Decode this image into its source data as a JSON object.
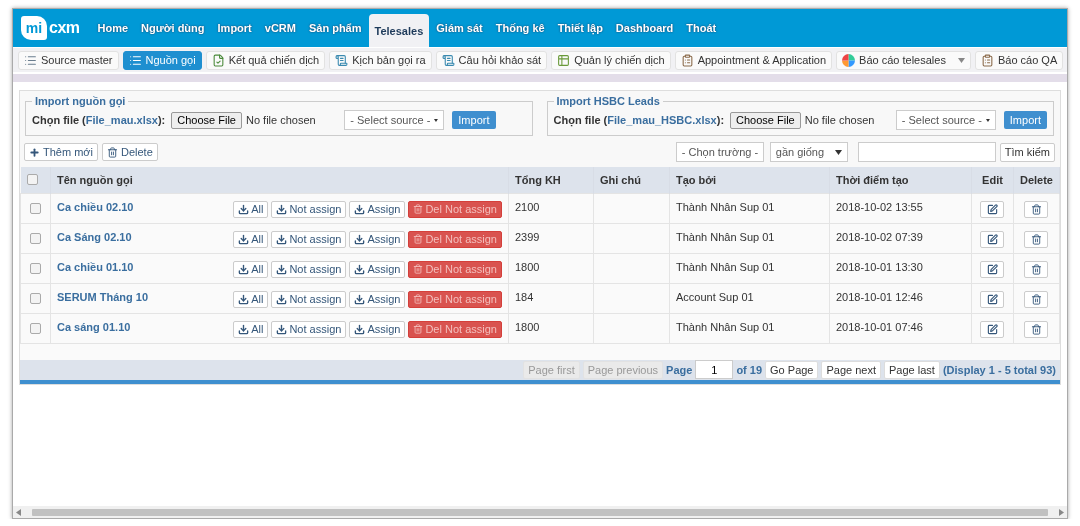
{
  "logo": {
    "text_a": "mi",
    "text_b": "cxm"
  },
  "menu": [
    {
      "label": "Home",
      "selected": false
    },
    {
      "label": "Người dùng",
      "selected": false
    },
    {
      "label": "Import",
      "selected": false
    },
    {
      "label": "vCRM",
      "selected": false
    },
    {
      "label": "Sản phẩm",
      "selected": false
    },
    {
      "label": "Telesales",
      "selected": true
    },
    {
      "label": "Giám sát",
      "selected": false
    },
    {
      "label": "Thống kê",
      "selected": false
    },
    {
      "label": "Thiết lập",
      "selected": false
    },
    {
      "label": "Dashboard",
      "selected": false
    },
    {
      "label": "Thoát",
      "selected": false
    }
  ],
  "submenu": [
    {
      "label": "Source master",
      "selected": false,
      "has_menu": false
    },
    {
      "label": "Nguồn gọi",
      "selected": true,
      "has_menu": false
    },
    {
      "label": "Kết quả chiến dịch",
      "selected": false,
      "has_menu": false
    },
    {
      "label": "Kịch bản gọi ra",
      "selected": false,
      "has_menu": false
    },
    {
      "label": "Câu hỏi khảo sát",
      "selected": false,
      "has_menu": false
    },
    {
      "label": "Quản lý chiến dịch",
      "selected": false,
      "has_menu": false
    },
    {
      "label": "Appointment & Application",
      "selected": false,
      "has_menu": false
    },
    {
      "label": "Báo cáo telesales",
      "selected": false,
      "has_menu": true
    },
    {
      "label": "Báo cáo QA",
      "selected": false,
      "has_menu": false
    }
  ],
  "imports": [
    {
      "legend": "Import nguồn gọi",
      "label_before": "Chọn file (",
      "link": "File_mau.xlsx",
      "label_after": "):",
      "choose_file": "Choose File",
      "file_status": "No file chosen",
      "select": "- Select source -",
      "button": "Import"
    },
    {
      "legend": "Import HSBC Leads",
      "label_before": "Chọn file (",
      "link": "File_mau_HSBC.xlsx",
      "label_after": "):",
      "choose_file": "Choose File",
      "file_status": "No file chosen",
      "select": "- Select source -",
      "button": "Import"
    }
  ],
  "toolbar": {
    "add": "Thêm mới",
    "delete": "Delete",
    "field_select": "- Chọn trường -",
    "match_select": "gần giống",
    "search_button": "Tìm kiếm"
  },
  "table": {
    "select_all": {
      "checked": false
    },
    "columns": [
      "Tên nguồn gọi",
      "Tổng KH",
      "Ghi chú",
      "Tạo bởi",
      "Thời điểm tạo",
      "Edit",
      "Delete"
    ],
    "rows": [
      {
        "checked": false,
        "name": "Ca chiều 02.10",
        "actions": [
          {
            "kind": "download",
            "label": "All"
          },
          {
            "kind": "download",
            "label": "Not assign"
          },
          {
            "kind": "download",
            "label": "Assign"
          },
          {
            "kind": "danger",
            "label": "Del Not assign"
          }
        ],
        "total": "2100",
        "created_by": "Thành Nhân Sup 01",
        "created_at": "2018-10-02 13:55"
      },
      {
        "checked": false,
        "name": "Ca Sáng 02.10",
        "actions": [
          {
            "kind": "download",
            "label": "All"
          },
          {
            "kind": "download",
            "label": "Not assign"
          },
          {
            "kind": "download",
            "label": "Assign"
          },
          {
            "kind": "danger",
            "label": "Del Not assign"
          }
        ],
        "total": "2399",
        "created_by": "Thành Nhân Sup 01",
        "created_at": "2018-10-02 07:39"
      },
      {
        "checked": false,
        "name": "Ca chiều 01.10",
        "actions": [
          {
            "kind": "download",
            "label": "All"
          },
          {
            "kind": "download",
            "label": "Not assign"
          },
          {
            "kind": "download",
            "label": "Assign"
          },
          {
            "kind": "danger",
            "label": "Del Not assign"
          }
        ],
        "total": "1800",
        "created_by": "Thành Nhân Sup 01",
        "created_at": "2018-10-01 13:30"
      },
      {
        "checked": false,
        "name": "SERUM Tháng 10",
        "actions": [
          {
            "kind": "download",
            "label": "All"
          },
          {
            "kind": "download",
            "label": "Not assign"
          },
          {
            "kind": "download",
            "label": "Assign"
          },
          {
            "kind": "danger",
            "label": "Del Not assign"
          }
        ],
        "total": "184",
        "created_by": "Account Sup 01",
        "created_at": "2018-10-01 12:46"
      },
      {
        "checked": false,
        "name": "Ca sáng 01.10",
        "actions": [
          {
            "kind": "download",
            "label": "All"
          },
          {
            "kind": "download",
            "label": "Not assign"
          },
          {
            "kind": "download",
            "label": "Assign"
          },
          {
            "kind": "danger",
            "label": "Del Not assign"
          }
        ],
        "total": "1800",
        "created_by": "Thành Nhân Sup 01",
        "created_at": "2018-10-01 07:46"
      }
    ]
  },
  "pagination": {
    "first": {
      "label": "Page first",
      "disabled": true
    },
    "previous": {
      "label": "Page previous",
      "disabled": true
    },
    "page_label": "Page",
    "page_value": "1",
    "of_pages": "of 19",
    "go": {
      "label": "Go Page",
      "disabled": false
    },
    "next": {
      "label": "Page next",
      "disabled": false
    },
    "last": {
      "label": "Page last",
      "disabled": false
    },
    "summary": "(Display 1 - 5 total 93)"
  }
}
